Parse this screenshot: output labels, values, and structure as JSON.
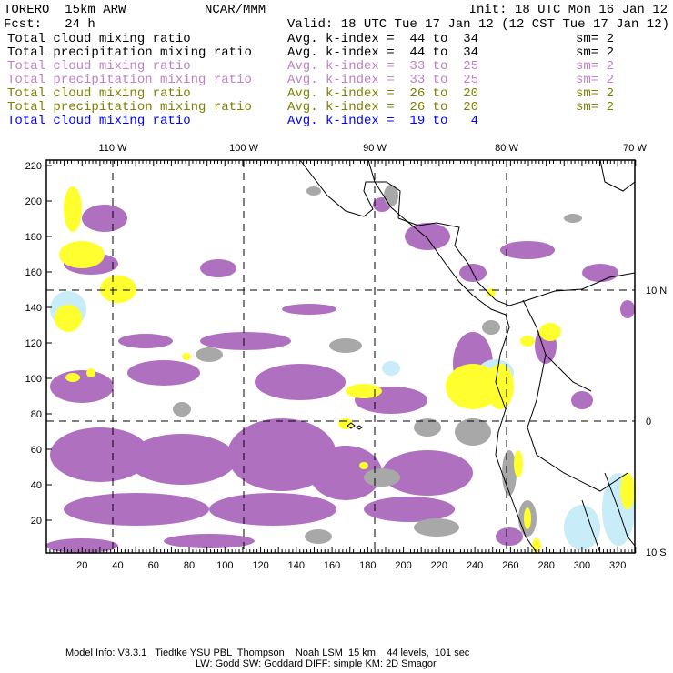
{
  "header": {
    "model": "TORERO  15km ARW",
    "org": "NCAR/MMM",
    "init": "Init: 18 UTC Mon 16 Jan 12",
    "fcst": "Fcst:   24 h",
    "valid": "Valid: 18 UTC Tue 17 Jan 12 (12 CST Tue 17 Jan 12)"
  },
  "legend": [
    {
      "field": "Total cloud mixing ratio",
      "range": "Avg. k-index =  44 to  34",
      "sm": "sm= 2",
      "color": "#000000"
    },
    {
      "field": "Total precipitation mixing ratio",
      "range": "Avg. k-index =  44 to  34",
      "sm": "sm= 2",
      "color": "#000000"
    },
    {
      "field": "Total cloud mixing ratio",
      "range": "Avg. k-index =  33 to  25",
      "sm": "sm= 2",
      "color": "#c080c8"
    },
    {
      "field": "Total precipitation mixing ratio",
      "range": "Avg. k-index =  33 to  25",
      "sm": "sm= 2",
      "color": "#c080c8"
    },
    {
      "field": "Total cloud mixing ratio",
      "range": "Avg. k-index =  26 to  20",
      "sm": "sm= 2",
      "color": "#808000"
    },
    {
      "field": "Total precipitation mixing ratio",
      "range": "Avg. k-index =  26 to  20",
      "sm": "sm= 2",
      "color": "#808000"
    },
    {
      "field": "Total cloud mixing ratio",
      "range": "Avg. k-index =  19 to   4",
      "sm": "",
      "color": "#0000ff"
    }
  ],
  "axes": {
    "x_ticks": [
      "20",
      "40",
      "60",
      "80",
      "100",
      "120",
      "140",
      "160",
      "180",
      "200",
      "220",
      "240",
      "260",
      "280",
      "300",
      "320"
    ],
    "y_ticks": [
      "20",
      "40",
      "60",
      "80",
      "100",
      "120",
      "140",
      "160",
      "180",
      "200",
      "220"
    ],
    "lon_labels": [
      "110 W",
      "100 W",
      "90 W",
      "80 W",
      "70 W"
    ],
    "lat_labels": [
      "10 N",
      "0",
      "10 S"
    ]
  },
  "footer": {
    "line1": "Model Info: V3.3.1   Tiedtke YSU PBL  Thompson    Noah LSM  15 km,   44 levels,  101 sec",
    "line2": "LW: Godd SW: Goddard DIFF: simple KM: 2D Smagor"
  },
  "colors": {
    "purple": "#b070c0",
    "grey": "#a8a8a8",
    "yellow": "#ffff30",
    "lightblue": "#c8ecf8"
  }
}
